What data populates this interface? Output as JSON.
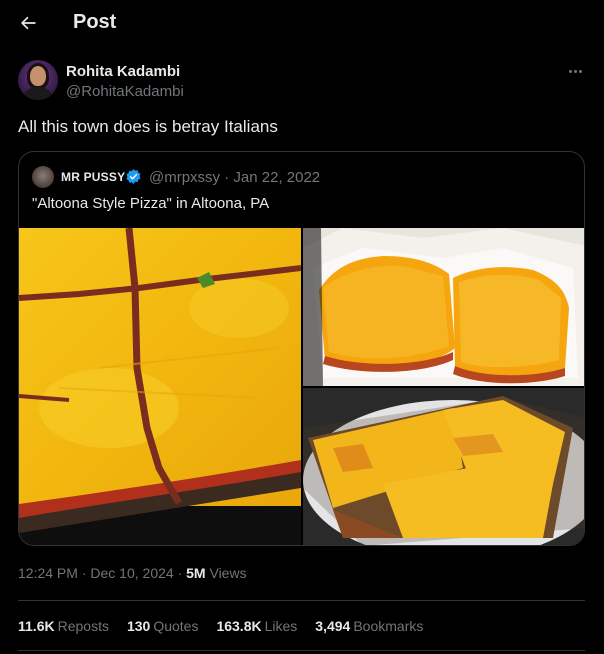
{
  "header": {
    "title": "Post",
    "back_icon": "arrow-left-icon"
  },
  "author": {
    "name": "Rohita Kadambi",
    "handle": "@RohitaKadambi"
  },
  "post": {
    "text": "All this town does is betray Italians"
  },
  "quote": {
    "name": "MR PUSSY",
    "verified": true,
    "handle": "@mrpxssy",
    "separator": "·",
    "date": "Jan 22, 2022",
    "text": "\"Altoona Style Pizza\" in Altoona, PA"
  },
  "meta": {
    "time": "12:24 PM",
    "separator": "·",
    "date": "Dec 10, 2024",
    "views_count": "5M",
    "views_label": "Views"
  },
  "engagement": {
    "reposts_count": "11.6K",
    "reposts_label": "Reposts",
    "quotes_count": "130",
    "quotes_label": "Quotes",
    "likes_count": "163.8K",
    "likes_label": "Likes",
    "bookmarks_count": "3,494",
    "bookmarks_label": "Bookmarks"
  },
  "colors": {
    "background": "#000000",
    "text": "#e7e9ea",
    "secondary": "#71767b",
    "border": "#2f3336",
    "verified": "#1d9bf0",
    "cheese": "#f2b51a"
  }
}
